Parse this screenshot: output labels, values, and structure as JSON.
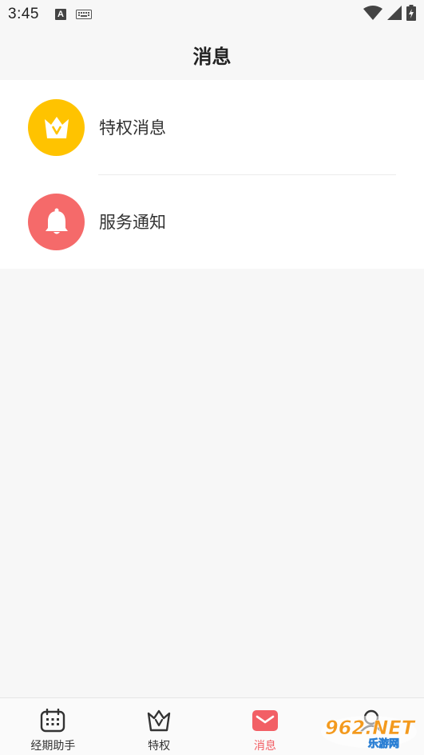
{
  "status_bar": {
    "time": "3:45",
    "icons": [
      "a-notification-icon",
      "keyboard-icon",
      "wifi-icon",
      "cell-signal-icon",
      "battery-icon"
    ]
  },
  "header": {
    "title": "消息"
  },
  "messages": {
    "items": [
      {
        "label": "特权消息",
        "icon": "crown-icon",
        "color": "#ffc300"
      },
      {
        "label": "服务通知",
        "icon": "bell-icon",
        "color": "#f56a6a"
      }
    ]
  },
  "tabs": {
    "items": [
      {
        "label": "经期助手",
        "icon": "calendar-icon",
        "active": false
      },
      {
        "label": "特权",
        "icon": "crown-outline-icon",
        "active": false
      },
      {
        "label": "消息",
        "icon": "mail-icon",
        "active": true
      },
      {
        "label": "",
        "icon": "user-icon",
        "active": false
      }
    ]
  },
  "watermark": {
    "text": "962.NET",
    "subtext": "乐游网"
  },
  "colors": {
    "accent": "#f25f65",
    "crown_bg": "#ffc300",
    "bell_bg": "#f56a6a",
    "background": "#f7f7f7"
  }
}
